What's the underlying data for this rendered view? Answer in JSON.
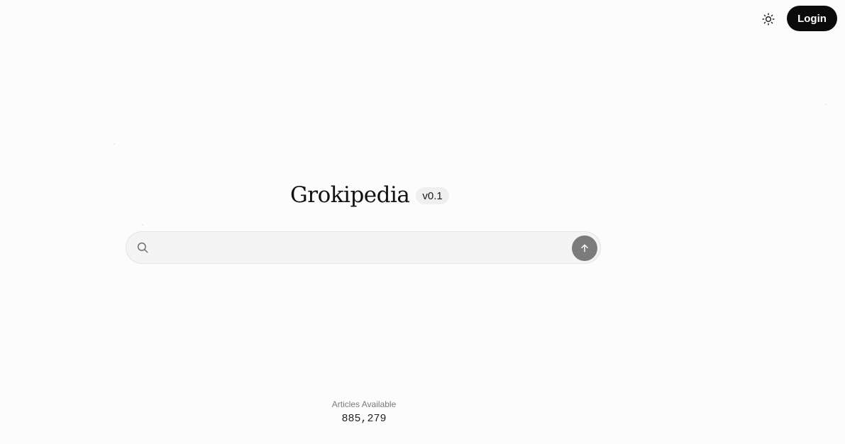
{
  "header": {
    "theme_toggle_icon": "sun-icon",
    "login_label": "Login"
  },
  "brand": {
    "title": "Grokipedia",
    "version": "v0.1"
  },
  "search": {
    "value": "",
    "placeholder": "",
    "search_icon": "search-icon",
    "submit_icon": "arrow-up-icon"
  },
  "stats": {
    "label": "Articles Available",
    "value": "885,279"
  },
  "colors": {
    "background": "#fcfcfc",
    "login_bg": "#0b0b0b",
    "submit_bg": "#7b7b7b",
    "search_bg": "#f4f4f4"
  }
}
